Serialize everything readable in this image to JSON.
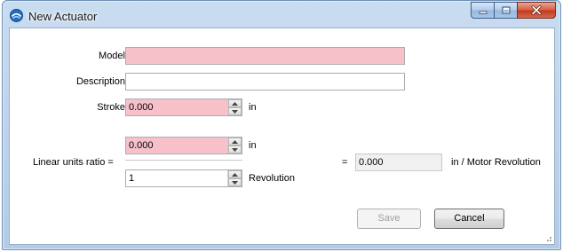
{
  "window": {
    "title": "New Actuator",
    "icon": "app-logo-icon",
    "caption_icons": [
      "minimize-icon",
      "maximize-icon",
      "close-icon"
    ]
  },
  "form": {
    "model": {
      "label": "Model",
      "value": ""
    },
    "description": {
      "label": "Description",
      "value": ""
    },
    "stroke": {
      "label": "Stroke",
      "value": "0.000",
      "unit": "in"
    },
    "linear_ratio": {
      "label": "Linear units ratio =",
      "numerator": {
        "value": "0.000",
        "unit": "in"
      },
      "denominator": {
        "value": "1",
        "unit": "Revolution"
      },
      "equals": "=",
      "result": {
        "value": "0.000",
        "unit": "in / Motor Revolution"
      }
    }
  },
  "buttons": {
    "save": "Save",
    "cancel": "Cancel"
  },
  "colors": {
    "required_field": "#f7c1ca",
    "titlebar": "#c9dcf0",
    "close_button": "#c2391e"
  }
}
